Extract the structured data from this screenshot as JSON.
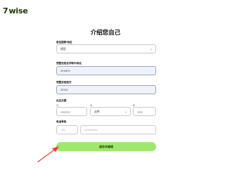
{
  "brand": {
    "logo_mark": "7",
    "logo_text": "wise"
  },
  "page": {
    "title": "介绍您自己"
  },
  "form": {
    "country": {
      "label": "居住国家/地区",
      "value": "德国"
    },
    "first_name": {
      "label": "完整法定名字和中间名",
      "value": "ZEWEN"
    },
    "last_name": {
      "label": "完整法定姓氏",
      "value": "ZENG"
    },
    "dob": {
      "label": "出生日期",
      "day_label": "日",
      "month_label": "月",
      "year_label": "年",
      "month_value": "选择"
    },
    "phone": {
      "label": "电话号码",
      "code_placeholder": "+49",
      "number_placeholder": "123455224"
    },
    "submit_label": "保存并继续"
  },
  "colors": {
    "accent": "#9fe870",
    "brand_dark": "#163300",
    "arrow": "#e5402f"
  }
}
